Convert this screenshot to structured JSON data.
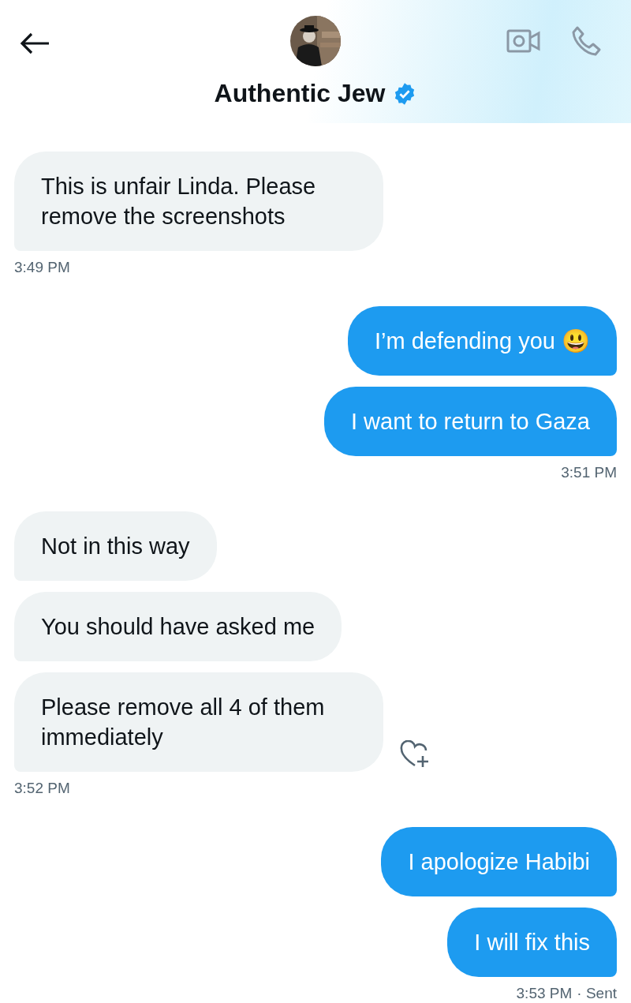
{
  "header": {
    "name": "Authentic Jew",
    "verified": true
  },
  "groups": [
    {
      "kind": "received",
      "messages": [
        {
          "text": "This is unfair Linda. Please remove the screenshots",
          "reaction": false
        }
      ],
      "time": "3:49 PM"
    },
    {
      "kind": "sent",
      "messages": [
        {
          "text": "I’m defending you 😃",
          "reaction": false
        },
        {
          "text": "I want to return to Gaza",
          "reaction": false
        }
      ],
      "time": "3:51 PM"
    },
    {
      "kind": "received",
      "messages": [
        {
          "text": "Not in this way",
          "reaction": false
        },
        {
          "text": "You should have asked me",
          "reaction": false
        },
        {
          "text": "Please remove all 4 of them immediately",
          "reaction": true
        }
      ],
      "time": "3:52 PM"
    },
    {
      "kind": "sent",
      "messages": [
        {
          "text": "I apologize Habibi",
          "reaction": false
        },
        {
          "text": "I will fix this",
          "reaction": false
        }
      ],
      "time": "3:53 PM",
      "status": "· Sent"
    }
  ]
}
